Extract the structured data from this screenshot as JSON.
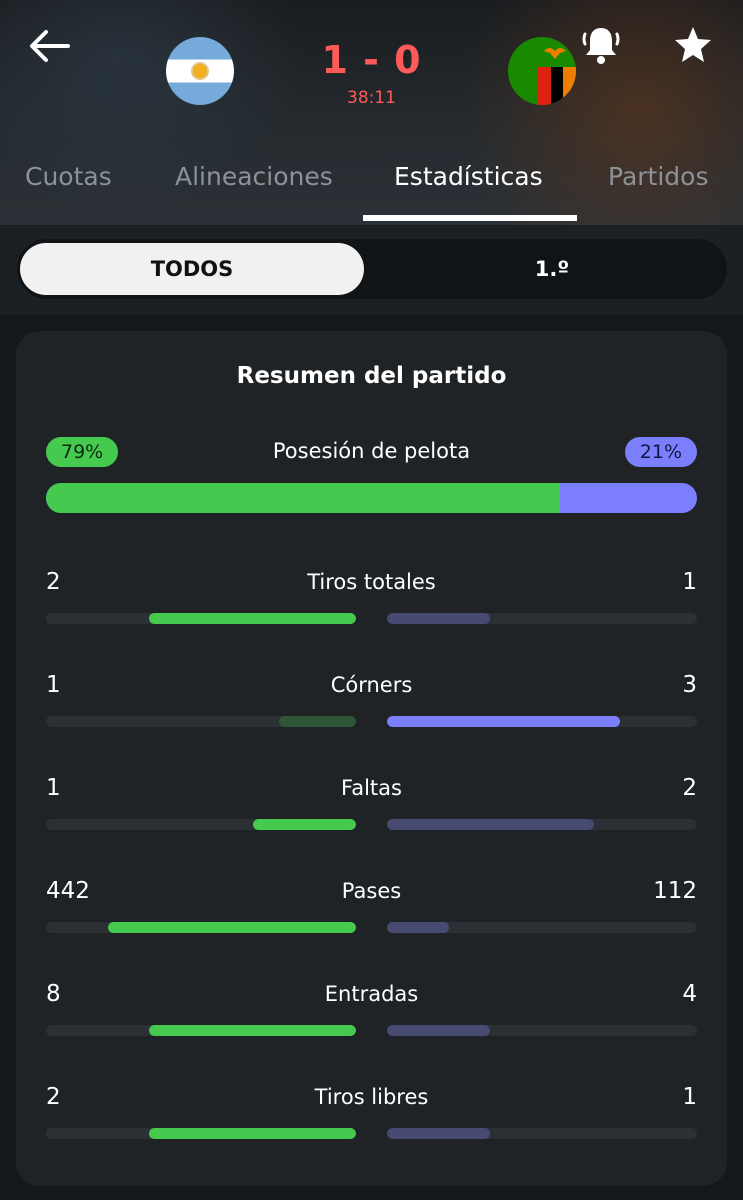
{
  "match": {
    "score": "1 - 0",
    "clock": "38:11",
    "home_team": {
      "flag_icon": "argentina-flag-icon"
    },
    "away_team": {
      "flag_icon": "zambia-flag-icon"
    }
  },
  "tabs": [
    {
      "label": "Cuotas",
      "active": false
    },
    {
      "label": "Alineaciones",
      "active": false
    },
    {
      "label": "Estadísticas",
      "active": true
    },
    {
      "label": "Partidos",
      "active": false
    }
  ],
  "period_filter": {
    "options": [
      "TODOS",
      "1.º"
    ],
    "selected": "TODOS"
  },
  "summary": {
    "title": "Resumen del partido",
    "possession": {
      "label": "Posesión de pelota",
      "home": "79%",
      "away": "21%",
      "home_fraction": 0.79
    }
  },
  "stats": [
    {
      "label": "Tiros totales",
      "home": "2",
      "away": "1",
      "home_fraction": 0.667,
      "away_fraction": 0.333,
      "leader": "home"
    },
    {
      "label": "Córners",
      "home": "1",
      "away": "3",
      "home_fraction": 0.25,
      "away_fraction": 0.75,
      "leader": "away"
    },
    {
      "label": "Faltas",
      "home": "1",
      "away": "2",
      "home_fraction": 0.333,
      "away_fraction": 0.667,
      "leader": "home"
    },
    {
      "label": "Pases",
      "home": "442",
      "away": "112",
      "home_fraction": 0.8,
      "away_fraction": 0.2,
      "leader": "home"
    },
    {
      "label": "Entradas",
      "home": "8",
      "away": "4",
      "home_fraction": 0.667,
      "away_fraction": 0.333,
      "leader": "home"
    },
    {
      "label": "Tiros libres",
      "home": "2",
      "away": "1",
      "home_fraction": 0.667,
      "away_fraction": 0.333,
      "leader": "home"
    }
  ],
  "colors": {
    "home_strong": "#45c94f",
    "home_muted": "#2f5637",
    "away_strong": "#7b7ffd",
    "away_muted": "#474b72",
    "score": "#ff5a5a"
  },
  "icons": {
    "back": "back-arrow-icon",
    "notifications": "bell-icon",
    "favorite": "star-icon"
  }
}
